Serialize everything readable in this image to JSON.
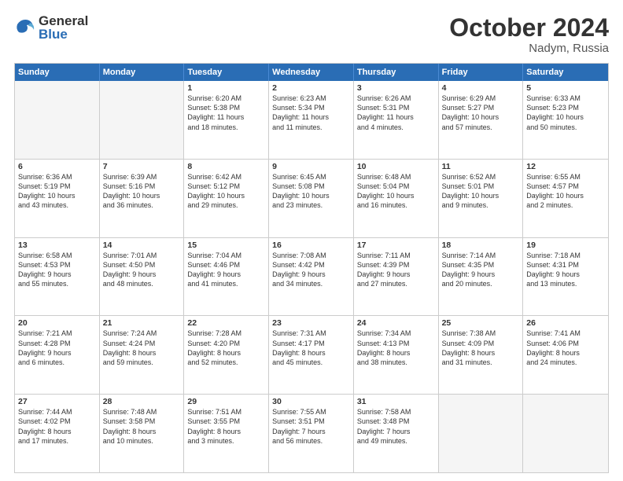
{
  "logo": {
    "general": "General",
    "blue": "Blue"
  },
  "header": {
    "month": "October 2024",
    "location": "Nadym, Russia"
  },
  "weekdays": [
    "Sunday",
    "Monday",
    "Tuesday",
    "Wednesday",
    "Thursday",
    "Friday",
    "Saturday"
  ],
  "rows": [
    [
      {
        "day": "",
        "text": "",
        "empty": true
      },
      {
        "day": "",
        "text": "",
        "empty": true
      },
      {
        "day": "1",
        "text": "Sunrise: 6:20 AM\nSunset: 5:38 PM\nDaylight: 11 hours\nand 18 minutes."
      },
      {
        "day": "2",
        "text": "Sunrise: 6:23 AM\nSunset: 5:34 PM\nDaylight: 11 hours\nand 11 minutes."
      },
      {
        "day": "3",
        "text": "Sunrise: 6:26 AM\nSunset: 5:31 PM\nDaylight: 11 hours\nand 4 minutes."
      },
      {
        "day": "4",
        "text": "Sunrise: 6:29 AM\nSunset: 5:27 PM\nDaylight: 10 hours\nand 57 minutes."
      },
      {
        "day": "5",
        "text": "Sunrise: 6:33 AM\nSunset: 5:23 PM\nDaylight: 10 hours\nand 50 minutes."
      }
    ],
    [
      {
        "day": "6",
        "text": "Sunrise: 6:36 AM\nSunset: 5:19 PM\nDaylight: 10 hours\nand 43 minutes."
      },
      {
        "day": "7",
        "text": "Sunrise: 6:39 AM\nSunset: 5:16 PM\nDaylight: 10 hours\nand 36 minutes."
      },
      {
        "day": "8",
        "text": "Sunrise: 6:42 AM\nSunset: 5:12 PM\nDaylight: 10 hours\nand 29 minutes."
      },
      {
        "day": "9",
        "text": "Sunrise: 6:45 AM\nSunset: 5:08 PM\nDaylight: 10 hours\nand 23 minutes."
      },
      {
        "day": "10",
        "text": "Sunrise: 6:48 AM\nSunset: 5:04 PM\nDaylight: 10 hours\nand 16 minutes."
      },
      {
        "day": "11",
        "text": "Sunrise: 6:52 AM\nSunset: 5:01 PM\nDaylight: 10 hours\nand 9 minutes."
      },
      {
        "day": "12",
        "text": "Sunrise: 6:55 AM\nSunset: 4:57 PM\nDaylight: 10 hours\nand 2 minutes."
      }
    ],
    [
      {
        "day": "13",
        "text": "Sunrise: 6:58 AM\nSunset: 4:53 PM\nDaylight: 9 hours\nand 55 minutes."
      },
      {
        "day": "14",
        "text": "Sunrise: 7:01 AM\nSunset: 4:50 PM\nDaylight: 9 hours\nand 48 minutes."
      },
      {
        "day": "15",
        "text": "Sunrise: 7:04 AM\nSunset: 4:46 PM\nDaylight: 9 hours\nand 41 minutes."
      },
      {
        "day": "16",
        "text": "Sunrise: 7:08 AM\nSunset: 4:42 PM\nDaylight: 9 hours\nand 34 minutes."
      },
      {
        "day": "17",
        "text": "Sunrise: 7:11 AM\nSunset: 4:39 PM\nDaylight: 9 hours\nand 27 minutes."
      },
      {
        "day": "18",
        "text": "Sunrise: 7:14 AM\nSunset: 4:35 PM\nDaylight: 9 hours\nand 20 minutes."
      },
      {
        "day": "19",
        "text": "Sunrise: 7:18 AM\nSunset: 4:31 PM\nDaylight: 9 hours\nand 13 minutes."
      }
    ],
    [
      {
        "day": "20",
        "text": "Sunrise: 7:21 AM\nSunset: 4:28 PM\nDaylight: 9 hours\nand 6 minutes."
      },
      {
        "day": "21",
        "text": "Sunrise: 7:24 AM\nSunset: 4:24 PM\nDaylight: 8 hours\nand 59 minutes."
      },
      {
        "day": "22",
        "text": "Sunrise: 7:28 AM\nSunset: 4:20 PM\nDaylight: 8 hours\nand 52 minutes."
      },
      {
        "day": "23",
        "text": "Sunrise: 7:31 AM\nSunset: 4:17 PM\nDaylight: 8 hours\nand 45 minutes."
      },
      {
        "day": "24",
        "text": "Sunrise: 7:34 AM\nSunset: 4:13 PM\nDaylight: 8 hours\nand 38 minutes."
      },
      {
        "day": "25",
        "text": "Sunrise: 7:38 AM\nSunset: 4:09 PM\nDaylight: 8 hours\nand 31 minutes."
      },
      {
        "day": "26",
        "text": "Sunrise: 7:41 AM\nSunset: 4:06 PM\nDaylight: 8 hours\nand 24 minutes."
      }
    ],
    [
      {
        "day": "27",
        "text": "Sunrise: 7:44 AM\nSunset: 4:02 PM\nDaylight: 8 hours\nand 17 minutes."
      },
      {
        "day": "28",
        "text": "Sunrise: 7:48 AM\nSunset: 3:58 PM\nDaylight: 8 hours\nand 10 minutes."
      },
      {
        "day": "29",
        "text": "Sunrise: 7:51 AM\nSunset: 3:55 PM\nDaylight: 8 hours\nand 3 minutes."
      },
      {
        "day": "30",
        "text": "Sunrise: 7:55 AM\nSunset: 3:51 PM\nDaylight: 7 hours\nand 56 minutes."
      },
      {
        "day": "31",
        "text": "Sunrise: 7:58 AM\nSunset: 3:48 PM\nDaylight: 7 hours\nand 49 minutes."
      },
      {
        "day": "",
        "text": "",
        "empty": true
      },
      {
        "day": "",
        "text": "",
        "empty": true
      }
    ]
  ]
}
